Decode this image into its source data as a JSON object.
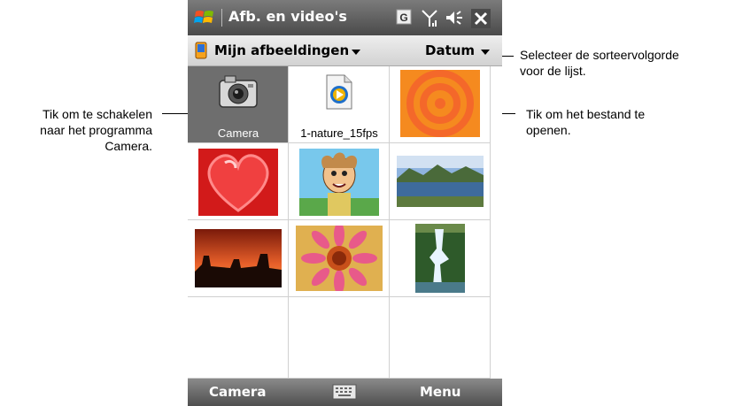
{
  "callouts": {
    "left": [
      "Tik om te schakelen",
      "naar het programma",
      "Camera."
    ],
    "top_right": [
      "Selecteer de sorteervolgorde",
      "voor de lijst."
    ],
    "mid_right": [
      "Tik om het bestand te",
      "openen."
    ]
  },
  "device": {
    "title": "Afb. en video's",
    "status_icons": [
      "windows-flag-icon",
      "gprs-g-icon",
      "signal-antenna-icon",
      "volume-icon",
      "close-icon"
    ],
    "toolbar": {
      "folder": "Mijn afbeeldingen",
      "sort": "Datum"
    },
    "grid": {
      "items": [
        {
          "label": "Camera",
          "icon": "camera-icon",
          "selected": true
        },
        {
          "label": "1-nature_15fps",
          "icon": "video-file-icon"
        },
        {
          "label": "",
          "icon": "orange-rings-thumbnail"
        },
        {
          "label": "",
          "icon": "heart-thumbnail"
        },
        {
          "label": "",
          "icon": "cartoon-man-thumbnail"
        },
        {
          "label": "",
          "icon": "lake-landscape-thumbnail"
        },
        {
          "label": "",
          "icon": "desert-sunset-thumbnail"
        },
        {
          "label": "",
          "icon": "flower-thumbnail"
        },
        {
          "label": "",
          "icon": "waterfall-thumbnail"
        }
      ]
    },
    "softkeys": {
      "left": "Camera",
      "center_icon": "keyboard-icon",
      "right": "Menu"
    }
  },
  "colors": {
    "titlebar": "#5a5a5a",
    "selected_cell": "#6e6e6e",
    "close_button": "#3b8ad6"
  }
}
